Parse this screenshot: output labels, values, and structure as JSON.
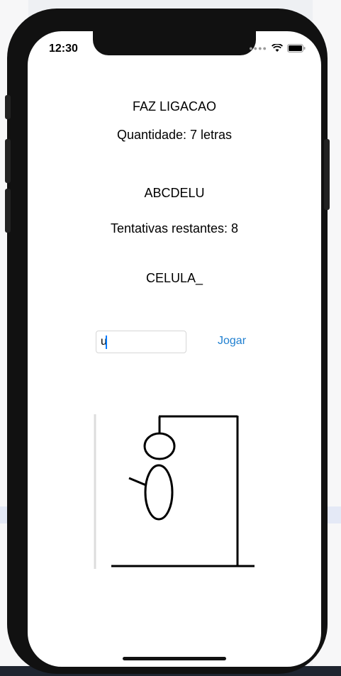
{
  "status_bar": {
    "time": "12:30"
  },
  "game": {
    "hint": "FAZ LIGACAO",
    "quantity": "Quantidade: 7 letras",
    "letters_tried": "ABCDELU",
    "attempts": "Tentativas restantes: 8",
    "word": "CELULA_"
  },
  "input": {
    "value": "u"
  },
  "button": {
    "label": "Jogar"
  },
  "colors": {
    "link": "#1f7fd0",
    "text": "#000000"
  }
}
